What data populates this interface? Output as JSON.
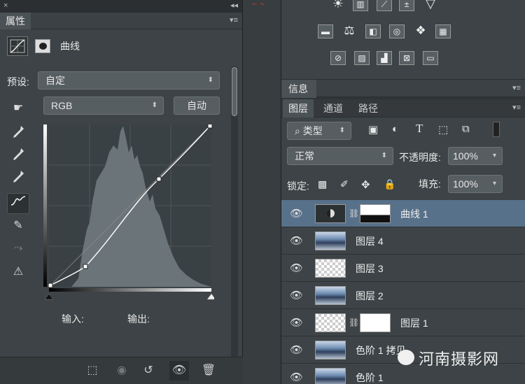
{
  "properties_panel": {
    "tab_label": "属性",
    "close_glyph": "×",
    "collapse_glyph": "◂◂",
    "menu_glyph": "▾≡",
    "adjustment_title": "曲线",
    "preset_label": "预设:",
    "preset_value": "自定",
    "channel_value": "RGB",
    "auto_button": "自动",
    "input_label": "输入:",
    "output_label": "输出:"
  },
  "mid_strip": {
    "marker": "⌐ ¬"
  },
  "info_panel": {
    "tab_label": "信息",
    "menu_glyph": "▾≡"
  },
  "layers_panel": {
    "tabs": [
      "图层",
      "通道",
      "路径"
    ],
    "filter_value": "类型",
    "blend_mode": "正常",
    "opacity_label": "不透明度:",
    "opacity_value": "100%",
    "lock_label": "锁定:",
    "fill_label": "填充:",
    "fill_value": "100%",
    "menu_glyph": "▾≡",
    "layers": [
      {
        "name": "曲线 1",
        "thumb": "adjust",
        "mask": "dark",
        "selected": true
      },
      {
        "name": "图层 4",
        "thumb": "photo",
        "mask": "",
        "selected": false
      },
      {
        "name": "图层 3",
        "thumb": "checker",
        "mask": "",
        "selected": false
      },
      {
        "name": "图层 2",
        "thumb": "photo",
        "mask": "",
        "selected": false
      },
      {
        "name": "图层 1",
        "thumb": "checker",
        "mask": "white",
        "selected": false
      },
      {
        "name": "色阶 1 拷贝",
        "thumb": "photo",
        "mask": "",
        "selected": false
      },
      {
        "name": "色阶 1",
        "thumb": "photo",
        "mask": "",
        "selected": false
      }
    ]
  },
  "watermark": "河南摄影网",
  "icons": {
    "properties_tools": [
      "channel-hand-icon",
      "black-eyedropper-icon",
      "gray-eyedropper-icon",
      "white-eyedropper-icon",
      "curve-points-icon",
      "pencil-icon",
      "smooth-icon",
      "clipping-warning-icon"
    ],
    "bottom_tools": [
      "clip-to-layer-icon",
      "view-previous-icon",
      "reset-icon",
      "visibility-eye-icon",
      "trash-icon"
    ]
  },
  "colors": {
    "selected_row": "#58718a",
    "panel_bg": "#3d4346"
  }
}
